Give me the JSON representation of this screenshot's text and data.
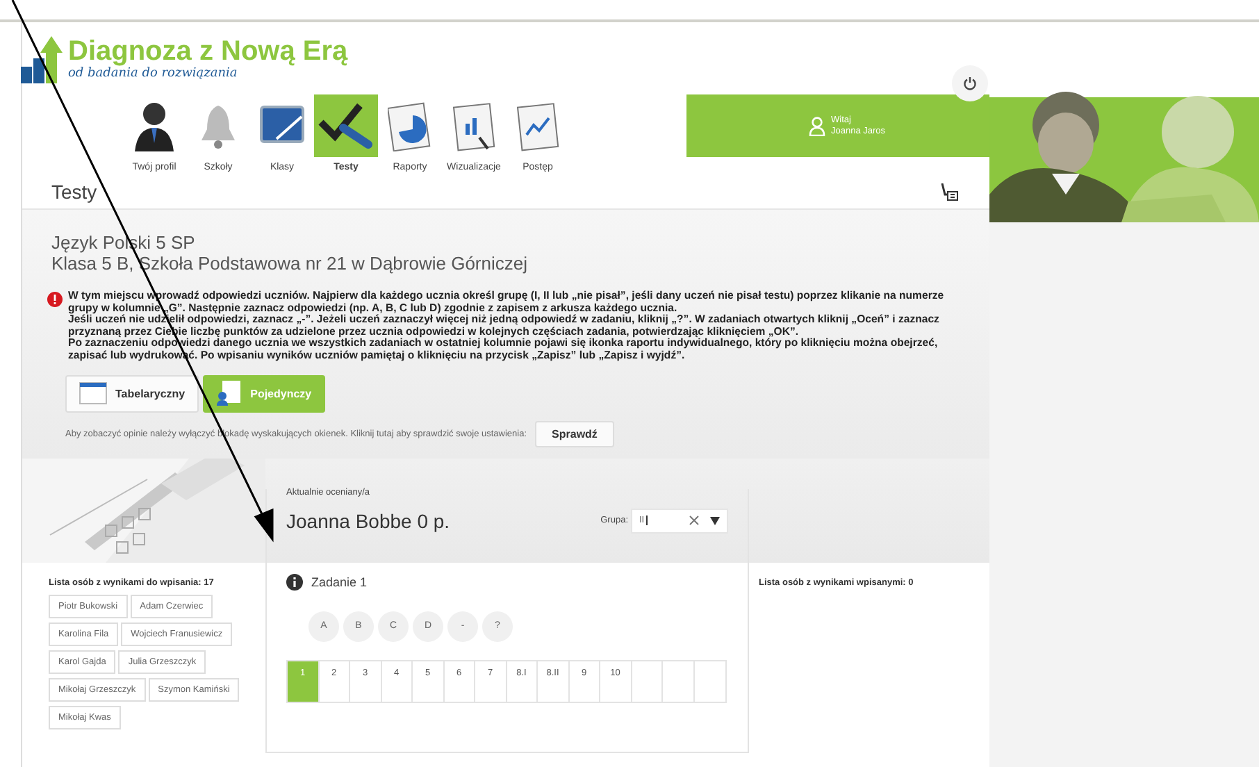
{
  "logo": {
    "title": "Diagnoza z Nową Erą",
    "tagline": "od badania do rozwiązania"
  },
  "nav": [
    {
      "label": "Twój profil",
      "selected": false
    },
    {
      "label": "Szkoły",
      "selected": false
    },
    {
      "label": "Klasy",
      "selected": false
    },
    {
      "label": "Testy",
      "selected": true
    },
    {
      "label": "Raporty",
      "selected": false
    },
    {
      "label": "Wizualizacje",
      "selected": false
    },
    {
      "label": "Postęp",
      "selected": false
    }
  ],
  "user": {
    "greeting": "Witaj",
    "name": "Joanna Jaros"
  },
  "page_title": "Testy",
  "course": {
    "subject": "Język Polski 5 SP",
    "class": "Klasa 5 B, Szkoła Podstawowa nr 21 w Dąbrowie Górniczej"
  },
  "notice": [
    "W tym miejscu wprowadź odpowiedzi uczniów. Najpierw dla każdego ucznia określ grupę (I, II lub „nie pisał”, jeśli dany uczeń nie pisał testu) poprzez klikanie na numerze grupy w kolumnie „G”. Następnie zaznacz odpowiedzi (np. A, B, C lub D) zgodnie z zapisem z arkusza każdego ucznia.",
    "Jeśli uczeń nie udzielił odpowiedzi, zaznacz „-”. Jeżeli uczeń zaznaczył więcej niż jedną odpowiedź w zadaniu, kliknij „?”. W zadaniach otwartych kliknij „Oceń” i zaznacz przyznaną przez Ciebie liczbę punktów za udzielone przez ucznia odpowiedzi w kolejnych częściach zadania, potwierdzając kliknięciem „OK”.",
    "Po zaznaczeniu odpowiedzi danego ucznia we wszystkich zadaniach w ostatniej kolumnie pojawi się ikonka raportu indywidualnego, który po kliknięciu można obejrzeć, zapisać lub wydrukować. Po wpisaniu wyników uczniów pamiętaj o kliknięciu na przycisk „Zapisz” lub „Zapisz i wyjdź”."
  ],
  "view_modes": [
    {
      "label": "Tabelaryczny",
      "selected": false
    },
    {
      "label": "Pojedynczy",
      "selected": true
    }
  ],
  "popup_hint": {
    "text": "Aby zobaczyć opinie należy wyłączyć blokadę wyskakujących okienek. Kliknij tutaj aby sprawdzić swoje ustawienia:",
    "button": "Sprawdź"
  },
  "pending_list": {
    "heading": "Lista osób z wynikami do wpisania: 17",
    "students": [
      "Piotr Bukowski",
      "Adam Czerwiec",
      "Karolina Fila",
      "Wojciech Franusiewicz",
      "Karol Gajda",
      "Julia Grzeszczyk",
      "Mikołaj Grzeszczyk",
      "Szymon Kamiński",
      "Mikołaj Kwas"
    ]
  },
  "current": {
    "label": "Aktualnie oceniany/a",
    "student": "Joanna Bobbe 0 p.",
    "group_label": "Grupa:",
    "group_value": "II"
  },
  "task": {
    "title": "Zadanie 1",
    "answers": [
      "A",
      "B",
      "C",
      "D",
      "-",
      "?"
    ],
    "tabs": [
      {
        "label": "1",
        "selected": true
      },
      {
        "label": "2",
        "selected": false
      },
      {
        "label": "3",
        "selected": false
      },
      {
        "label": "4",
        "selected": false
      },
      {
        "label": "5",
        "selected": false
      },
      {
        "label": "6",
        "selected": false
      },
      {
        "label": "7",
        "selected": false
      },
      {
        "label": "8.I",
        "selected": false
      },
      {
        "label": "8.II",
        "selected": false
      },
      {
        "label": "9",
        "selected": false
      },
      {
        "label": "10",
        "selected": false
      }
    ]
  },
  "done_list": {
    "heading": "Lista osób z wynikami wpisanymi: 0"
  }
}
